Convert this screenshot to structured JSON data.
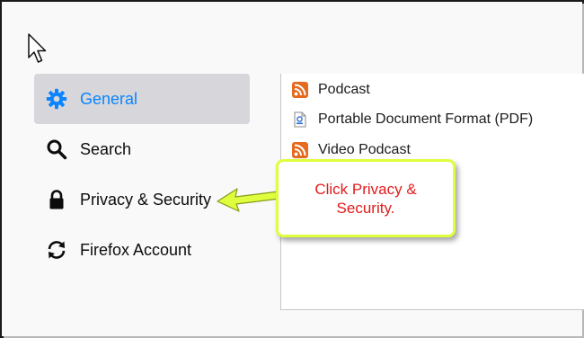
{
  "sidebar": {
    "items": [
      {
        "label": "General",
        "icon": "gear-icon",
        "selected": true
      },
      {
        "label": "Search",
        "icon": "search-icon",
        "selected": false
      },
      {
        "label": "Privacy & Security",
        "icon": "lock-icon",
        "selected": false
      },
      {
        "label": "Firefox Account",
        "icon": "sync-icon",
        "selected": false
      }
    ]
  },
  "applications": {
    "items": [
      {
        "label": "Podcast",
        "icon": "rss-feed-icon"
      },
      {
        "label": "Portable Document Format (PDF)",
        "icon": "pdf-file-icon"
      },
      {
        "label": "Video Podcast",
        "icon": "rss-feed-icon"
      }
    ]
  },
  "annotation": {
    "text": "Click Privacy &\nSecurity.",
    "colors": {
      "text": "#e21b1b",
      "border": "#dfff3e",
      "arrow": "#dfff3e"
    }
  },
  "colors": {
    "accent": "#0a84ff",
    "selected_bg": "#d7d7db"
  }
}
